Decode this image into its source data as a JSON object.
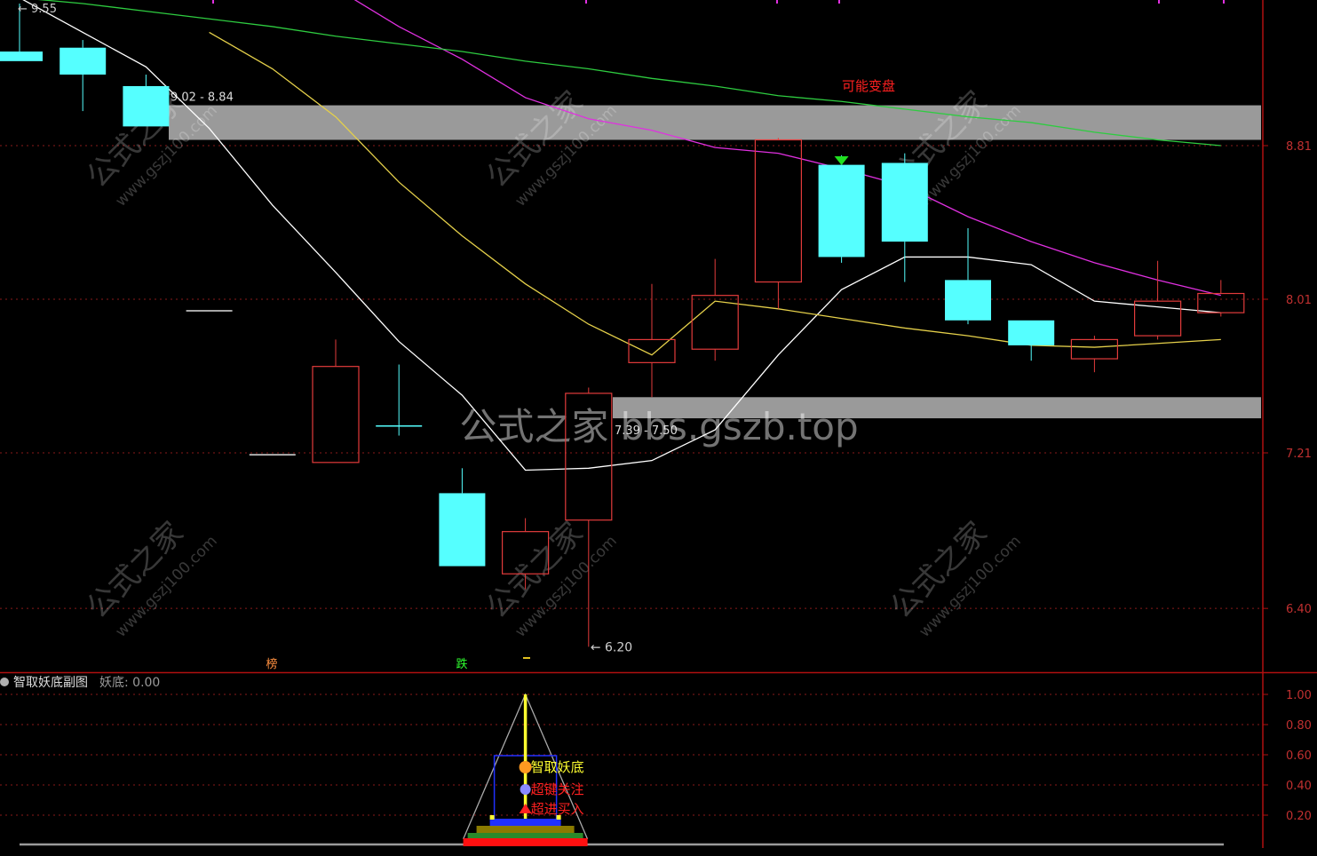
{
  "chart_data": [
    {
      "type": "candlestick",
      "title": "",
      "y_axis": {
        "ticks": [
          "8.81",
          "8.01",
          "7.21",
          "6.40"
        ],
        "ylim": [
          6.0,
          9.6
        ],
        "side": "right"
      },
      "grid": "dotted-horizontal",
      "candles": [
        {
          "open": 9.3,
          "close": 9.25,
          "high": 9.55,
          "low": 9.25
        },
        {
          "open": 9.32,
          "close": 9.18,
          "high": 9.36,
          "low": 8.99
        },
        {
          "open": 9.12,
          "close": 8.91,
          "high": 9.18,
          "low": 8.91
        },
        {
          "open": 7.95,
          "close": 7.95,
          "high": 7.95,
          "low": 7.95
        },
        {
          "open": 7.2,
          "close": 7.2,
          "high": 7.2,
          "low": 7.2
        },
        {
          "open": 7.16,
          "close": 7.66,
          "high": 7.8,
          "low": 7.16
        },
        {
          "open": 7.35,
          "close": 7.35,
          "high": 7.67,
          "low": 7.3
        },
        {
          "open": 7.0,
          "close": 6.62,
          "high": 7.13,
          "low": 6.62
        },
        {
          "open": 6.58,
          "close": 6.8,
          "high": 6.87,
          "low": 6.5
        },
        {
          "open": 6.86,
          "close": 7.52,
          "high": 7.55,
          "low": 6.2
        },
        {
          "open": 7.68,
          "close": 7.8,
          "high": 8.09,
          "low": 7.5
        },
        {
          "open": 7.75,
          "close": 8.03,
          "high": 8.22,
          "low": 7.69
        },
        {
          "open": 8.1,
          "close": 8.84,
          "high": 8.85,
          "low": 7.96
        },
        {
          "open": 8.71,
          "close": 8.23,
          "high": 8.76,
          "low": 8.2
        },
        {
          "open": 8.72,
          "close": 8.31,
          "high": 8.77,
          "low": 8.1
        },
        {
          "open": 8.11,
          "close": 7.9,
          "high": 8.38,
          "low": 7.88
        },
        {
          "open": 7.9,
          "close": 7.77,
          "high": 7.9,
          "low": 7.69
        },
        {
          "open": 7.7,
          "close": 7.8,
          "high": 7.82,
          "low": 7.63
        },
        {
          "open": 7.82,
          "close": 8.0,
          "high": 8.21,
          "low": 7.8
        },
        {
          "open": 7.94,
          "close": 8.04,
          "high": 8.11,
          "low": 7.92
        }
      ],
      "series": [
        {
          "name": "",
          "color": "#ffffff",
          "values": [
            9.58,
            9.4,
            9.22,
            8.9,
            8.5,
            8.15,
            7.79,
            7.51,
            7.12,
            7.13,
            7.17,
            7.33,
            7.72,
            8.06,
            8.23,
            8.23,
            8.19,
            8.0,
            7.97,
            7.94
          ]
        },
        {
          "name": "",
          "color": "#e5d04a",
          "values": [
            null,
            null,
            null,
            9.4,
            9.21,
            8.96,
            8.62,
            8.34,
            8.09,
            7.88,
            7.72,
            8.0,
            7.96,
            7.91,
            7.86,
            7.82,
            7.77,
            7.76,
            7.78,
            7.8
          ]
        },
        {
          "name": "",
          "color": "#e030e0",
          "values": [
            null,
            null,
            null,
            null,
            null,
            9.63,
            9.43,
            9.26,
            9.06,
            8.95,
            8.89,
            8.8,
            8.77,
            8.69,
            8.6,
            8.44,
            8.31,
            8.2,
            8.11,
            8.03
          ]
        },
        {
          "name": "",
          "color": "#2ecc40",
          "values": [
            9.58,
            9.55,
            9.51,
            9.47,
            9.43,
            9.38,
            9.34,
            9.3,
            9.25,
            9.21,
            9.16,
            9.12,
            9.07,
            9.04,
            9.0,
            8.96,
            8.93,
            8.88,
            8.84,
            8.81
          ]
        }
      ],
      "bands": [
        {
          "label": "9.02 - 8.84",
          "low": 8.84,
          "high": 9.02
        },
        {
          "label": "7.39 - 7.50",
          "low": 7.39,
          "high": 7.5
        }
      ],
      "annotations": {
        "high_label": "9.55",
        "low_label": "6.20",
        "signal_text": "可能变盘",
        "bottom_markers": [
          "榜",
          "跌"
        ]
      },
      "watermarks": {
        "stamp_a": "公式之家",
        "stamp_b": "www.gszj100.com",
        "center": "公式之家 bbs.gszb.top"
      }
    },
    {
      "type": "indicator",
      "panel_title": "智取妖底副图",
      "value_label": "妖底: 0.00",
      "y_axis": {
        "ticks": [
          "1.00",
          "0.80",
          "0.60",
          "0.40",
          "0.20"
        ],
        "ylim": [
          0,
          1.05
        ]
      },
      "signal_index": 8,
      "signal_value": 1.0,
      "legend": [
        {
          "text": "智取妖底",
          "color": "#ffff30"
        },
        {
          "text": "超键关注",
          "color": "#ff2020"
        },
        {
          "text": "超进买入",
          "color": "#ff2020"
        }
      ]
    }
  ],
  "colors": {
    "up": "#e23b3b",
    "down": "#55ffff",
    "grid": "#8a1a1a",
    "axis": "#b01010",
    "band": "#9a9a9a",
    "text": "#c0c0c0"
  }
}
